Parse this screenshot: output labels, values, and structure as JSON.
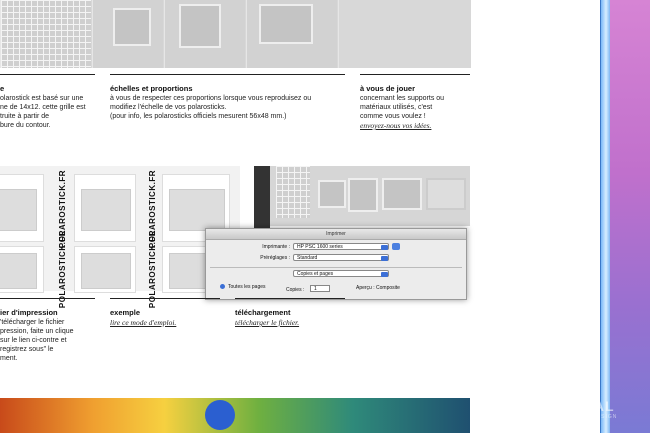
{
  "col1": {
    "lines": [
      "e",
      "olarostick est basé sur une",
      "ne de 14x12. cette grille est",
      "truite à partir de",
      "bure du contour."
    ]
  },
  "col2": {
    "title": "échelles et proportions",
    "lines": [
      "à vous de respecter ces proportions lorsque vous reproduisez ou",
      "modifiez l'échelle de vos polarosticks.",
      "(pour info, les polarosticks officiels mesurent 56x48 mm.)"
    ]
  },
  "col3": {
    "title": "à vous de jouer",
    "lines": [
      "concernant les supports ou",
      "matériaux utilisés, c'est",
      "comme vous voulez !"
    ],
    "link": "envoyez-nous vos idées."
  },
  "template": {
    "card_label": "POLAROSTICK.FR"
  },
  "dialog": {
    "title": "Imprimer",
    "printer_label": "Imprimante :",
    "printer_value": "HP PSC 1600 series",
    "presets_label": "Préréglages :",
    "presets_value": "Standard",
    "section_value": "Copies et pages",
    "all_pages": "Toutes les pages",
    "copies_label": "Copies :",
    "copies_value": "1",
    "preview_label": "Aperçu : Composite"
  },
  "bottom1": {
    "title": "ier d'impression",
    "lines": [
      "'télécharger le fichier",
      "pression, faite un clique",
      "sur le lien ci-contre et",
      "registrez sous\" le",
      "ment."
    ]
  },
  "bottom2": {
    "title": "exemple",
    "link": "lire ce mode d'emploi."
  },
  "bottom3": {
    "title": "téléchargement",
    "link": "télécharger le fichier."
  },
  "watermark": {
    "main": "VALGAL",
    "sub": "GRAPHIC DESIGN"
  }
}
